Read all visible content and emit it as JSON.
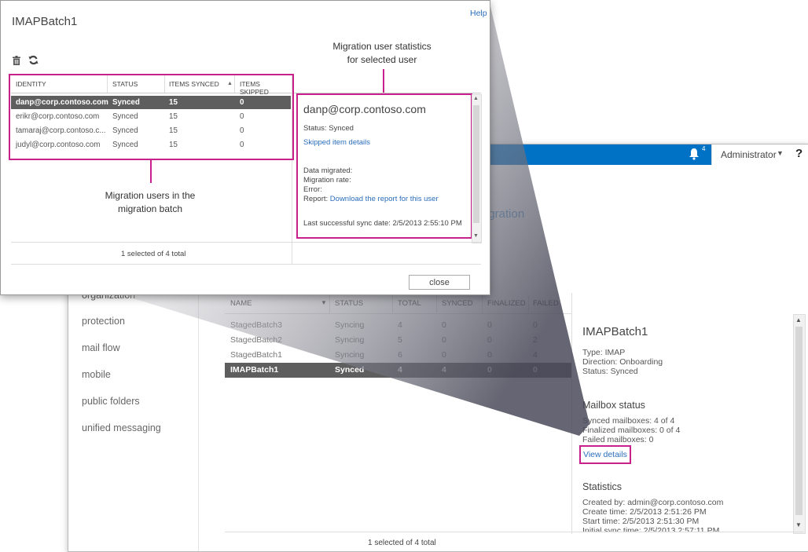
{
  "dialog": {
    "title": "IMAPBatch1",
    "help": "Help",
    "annotation_stats_line1": "Migration user statistics",
    "annotation_stats_line2": "for selected user",
    "annotation_users_line1": "Migration users in the",
    "annotation_users_line2": "migration batch",
    "columns": [
      "IDENTITY",
      "STATUS",
      "ITEMS SYNCED",
      "ITEMS SKIPPED"
    ],
    "users": [
      {
        "identity": "danp@corp.contoso.com",
        "status": "Synced",
        "synced": "15",
        "skipped": "0",
        "selected": true
      },
      {
        "identity": "erikr@corp.contoso.com",
        "status": "Synced",
        "synced": "15",
        "skipped": "0",
        "selected": false
      },
      {
        "identity": "tamaraj@corp.contoso.c...",
        "status": "Synced",
        "synced": "15",
        "skipped": "0",
        "selected": false
      },
      {
        "identity": "judyl@corp.contoso.com",
        "status": "Synced",
        "synced": "15",
        "skipped": "0",
        "selected": false
      }
    ],
    "status_text": "1 selected of 4 total",
    "close_label": "close",
    "stats": {
      "email": "danp@corp.contoso.com",
      "status": "Status: Synced",
      "skipped_link": "Skipped item details",
      "data_migrated": "Data migrated:",
      "migration_rate": "Migration rate:",
      "error": "Error:",
      "report_label": "Report:",
      "report_link": "Download the report for this user",
      "last_sync": "Last successful sync date: 2/5/2013 2:55:10 PM"
    }
  },
  "background": {
    "topbar": {
      "notification_count": "4",
      "user": "Administrator",
      "help": "?"
    },
    "page_title_fragment": "igration",
    "nav": [
      "organization",
      "protection",
      "mail flow",
      "mobile",
      "public folders",
      "unified messaging"
    ],
    "columns": [
      "NAME",
      "STATUS",
      "TOTAL",
      "SYNCED",
      "FINALIZED",
      "FAILED"
    ],
    "batches": [
      {
        "name": "StagedBatch3",
        "status": "Syncing",
        "total": "4",
        "synced": "0",
        "finalized": "0",
        "failed": "0",
        "selected": false
      },
      {
        "name": "StagedBatch2",
        "status": "Syncing",
        "total": "5",
        "synced": "0",
        "finalized": "0",
        "failed": "2",
        "selected": false
      },
      {
        "name": "StagedBatch1",
        "status": "Syncing",
        "total": "6",
        "synced": "0",
        "finalized": "0",
        "failed": "4",
        "selected": false
      },
      {
        "name": "IMAPBatch1",
        "status": "Synced",
        "total": "4",
        "synced": "4",
        "finalized": "0",
        "failed": "0",
        "selected": true
      }
    ],
    "details": {
      "title": "IMAPBatch1",
      "type": "Type: IMAP",
      "direction": "Direction: Onboarding",
      "status": "Status: Synced",
      "mailbox_heading": "Mailbox status",
      "synced_mailboxes": "Synced mailboxes: 4 of 4",
      "finalized_mailboxes": "Finalized mailboxes: 0 of 4",
      "failed_mailboxes": "Failed mailboxes: 0",
      "view_details": "View details",
      "statistics_heading": "Statistics",
      "created_by": "Created by: admin@corp.contoso.com",
      "create_time": "Create time: 2/5/2013 2:51:26 PM",
      "start_time": "Start time: 2/5/2013 2:51:30 PM",
      "initial_sync": "Initial sync time: 2/5/2013 2:57:11 PM"
    },
    "status_text": "1 selected of 4 total"
  },
  "colors": {
    "accent": "#0072c6",
    "highlight": "#c8218c",
    "selected_row": "#5e5e5e",
    "link": "#2a6ebb"
  }
}
